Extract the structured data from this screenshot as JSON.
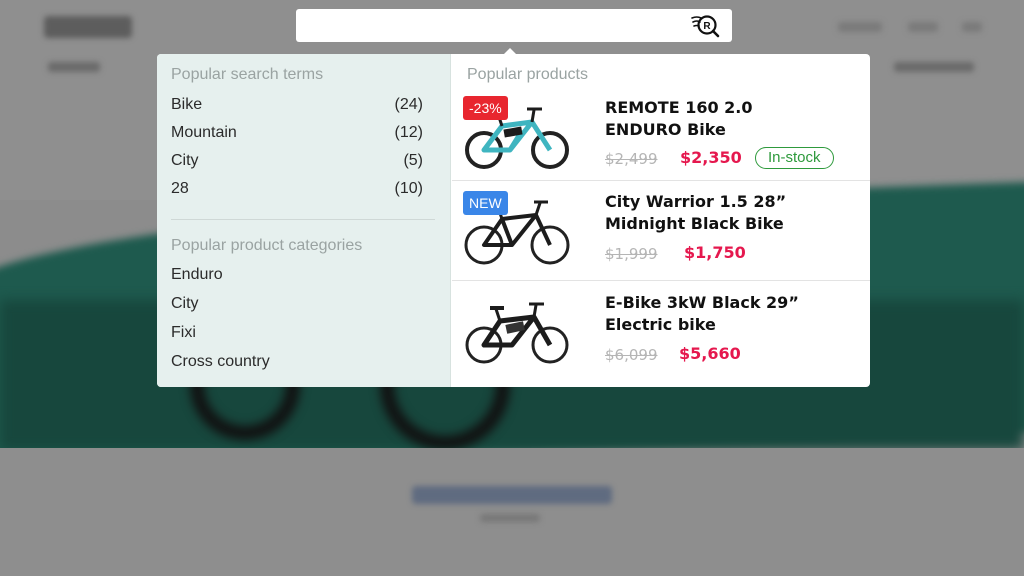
{
  "search": {
    "placeholder": "",
    "value": ""
  },
  "left": {
    "terms_title": "Popular search terms",
    "terms": [
      {
        "label": "Bike",
        "count": "(24)"
      },
      {
        "label": "Mountain",
        "count": "(12)"
      },
      {
        "label": "City",
        "count": "(5)"
      },
      {
        "label": "28",
        "count": "(10)"
      }
    ],
    "categories_title": "Popular product categories",
    "categories": [
      "Enduro",
      "City",
      "Fixi",
      "Cross country"
    ]
  },
  "right": {
    "title": "Popular products",
    "products": [
      {
        "badge": "-23%",
        "name_line1": "REMOTE 160 2.0",
        "name_line2": "ENDURO Bike",
        "old_price": "$2,499",
        "price": "$2,350",
        "stock": "In-stock",
        "frame_color": "#3fb5c0"
      },
      {
        "badge": "NEW",
        "name_line1": "City Warrior 1.5 28”",
        "name_line2": "Midnight Black Bike",
        "old_price": "$1,999",
        "price": "$1,750",
        "frame_color": "#1c1c1c"
      },
      {
        "name_line1": "E-Bike 3kW Black 29”",
        "name_line2": "Electric bike",
        "old_price": "$6,099",
        "price": "$5,660",
        "frame_color": "#1c1c1c"
      }
    ]
  },
  "colors": {
    "price": "#e5184e",
    "in_stock": "#2e9a3c",
    "sale_badge": "#e8262f",
    "new_badge": "#3a86e8",
    "left_panel_bg": "#e6f0ee"
  }
}
